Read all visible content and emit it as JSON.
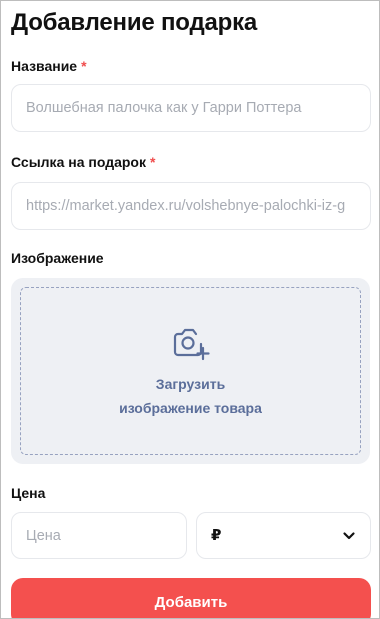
{
  "page": {
    "title": "Добавление подарка"
  },
  "form": {
    "name": {
      "label": "Название",
      "required_mark": "*",
      "placeholder": "Волшебная палочка как у Гарри Поттера"
    },
    "link": {
      "label": "Ссылка на подарок",
      "required_mark": "*",
      "placeholder": "https://market.yandex.ru/volshebnye-palochki-iz-g"
    },
    "image": {
      "label": "Изображение",
      "upload_line1": "Загрузить",
      "upload_line2": "изображение товара",
      "icon": "camera-add-icon"
    },
    "price": {
      "label": "Цена",
      "placeholder": "Цена",
      "currency_value": "₽",
      "currency_icon": "chevron-down-icon"
    },
    "submit_label": "Добавить"
  },
  "colors": {
    "accent": "#f4504e",
    "required": "#f04d4d",
    "upload_text": "#5b6e9a",
    "upload_bg": "#eef0f4"
  }
}
